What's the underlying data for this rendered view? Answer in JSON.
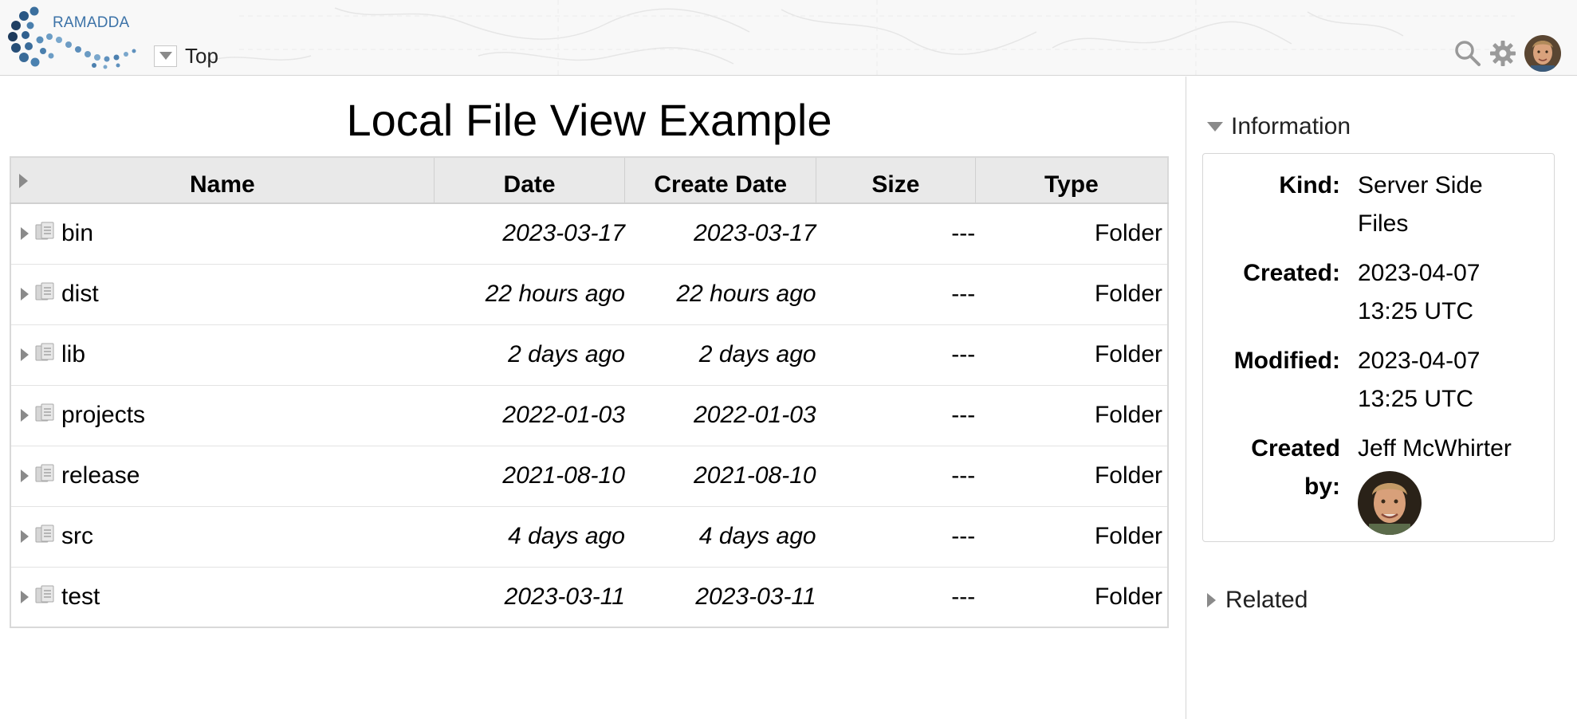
{
  "app": {
    "logo_text": "RAMADDA",
    "breadcrumb_top": "Top"
  },
  "header": {
    "icons": [
      "search-icon",
      "gear-icon",
      "user-avatar"
    ]
  },
  "page": {
    "title": "Local File View Example"
  },
  "table": {
    "columns": [
      "Name",
      "Date",
      "Create Date",
      "Size",
      "Type"
    ],
    "rows": [
      {
        "name": "bin",
        "date": "2023-03-17",
        "create_date": "2023-03-17",
        "size": "---",
        "type": "Folder"
      },
      {
        "name": "dist",
        "date": "22 hours ago",
        "create_date": "22 hours ago",
        "size": "---",
        "type": "Folder"
      },
      {
        "name": "lib",
        "date": "2 days ago",
        "create_date": "2 days ago",
        "size": "---",
        "type": "Folder"
      },
      {
        "name": "projects",
        "date": "2022-01-03",
        "create_date": "2022-01-03",
        "size": "---",
        "type": "Folder"
      },
      {
        "name": "release",
        "date": "2021-08-10",
        "create_date": "2021-08-10",
        "size": "---",
        "type": "Folder"
      },
      {
        "name": "src",
        "date": "4 days ago",
        "create_date": "4 days ago",
        "size": "---",
        "type": "Folder"
      },
      {
        "name": "test",
        "date": "2023-03-11",
        "create_date": "2023-03-11",
        "size": "---",
        "type": "Folder"
      }
    ]
  },
  "sidebar": {
    "information_title": "Information",
    "related_title": "Related",
    "info": {
      "kind_label": "Kind:",
      "kind_value_1": "Server Side",
      "kind_value_2": "Files",
      "created_label": "Created:",
      "created_value_1": "2023-04-07",
      "created_value_2": "13:25 UTC",
      "modified_label": "Modified:",
      "modified_value_1": "2023-04-07",
      "modified_value_2": "13:25 UTC",
      "createdby_label_1": "Created",
      "createdby_label_2": "by:",
      "createdby_value": "Jeff McWhirter"
    }
  },
  "colors": {
    "header_bg": "#f8f8f8",
    "logo_blue": "#3d73a8",
    "table_header_bg": "#e9e9e9",
    "border": "#d6d6d6"
  }
}
